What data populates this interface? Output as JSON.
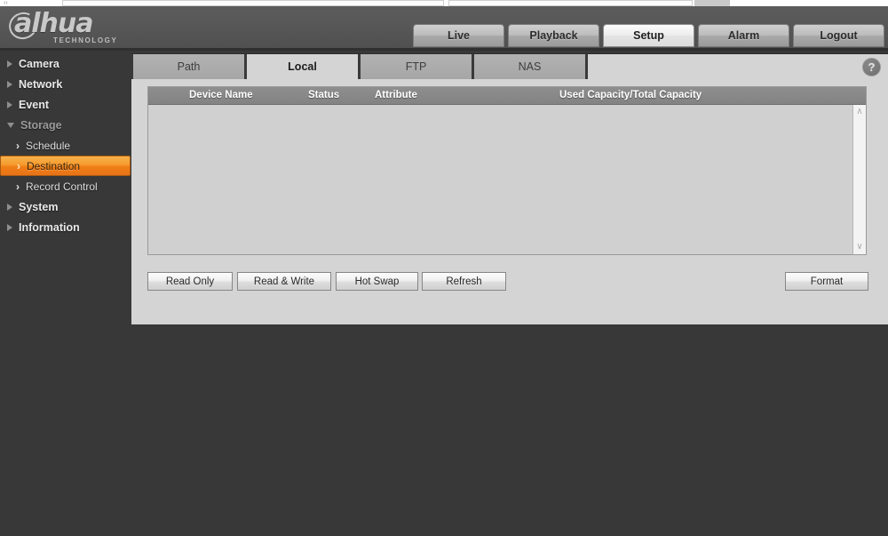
{
  "brand": {
    "name": "alhua",
    "tagline": "TECHNOLOGY"
  },
  "topnav": {
    "items": [
      {
        "label": "Live",
        "active": false
      },
      {
        "label": "Playback",
        "active": false
      },
      {
        "label": "Setup",
        "active": true
      },
      {
        "label": "Alarm",
        "active": false
      },
      {
        "label": "Logout",
        "active": false
      }
    ]
  },
  "sidebar": {
    "items": [
      {
        "label": "Camera",
        "level": 1,
        "icon": "arrow-right-icon",
        "state": "collapsed"
      },
      {
        "label": "Network",
        "level": 1,
        "icon": "arrow-right-icon",
        "state": "collapsed"
      },
      {
        "label": "Event",
        "level": 1,
        "icon": "arrow-right-icon",
        "state": "collapsed"
      },
      {
        "label": "Storage",
        "level": 1,
        "icon": "arrow-down-icon",
        "state": "expanded"
      },
      {
        "label": "Schedule",
        "level": 2,
        "icon": "chevron-right-icon",
        "state": "normal"
      },
      {
        "label": "Destination",
        "level": 2,
        "icon": "chevron-right-icon",
        "state": "selected"
      },
      {
        "label": "Record Control",
        "level": 2,
        "icon": "chevron-right-icon",
        "state": "normal"
      },
      {
        "label": "System",
        "level": 1,
        "icon": "arrow-right-icon",
        "state": "collapsed"
      },
      {
        "label": "Information",
        "level": 1,
        "icon": "arrow-right-icon",
        "state": "collapsed"
      }
    ]
  },
  "help": {
    "glyph": "?"
  },
  "tabs": [
    {
      "label": "Path",
      "active": false
    },
    {
      "label": "Local",
      "active": true
    },
    {
      "label": "FTP",
      "active": false
    },
    {
      "label": "NAS",
      "active": false
    }
  ],
  "table": {
    "columns": [
      "Device Name",
      "Status",
      "Attribute",
      "Used Capacity/Total Capacity"
    ],
    "rows": []
  },
  "scrollbar": {
    "up_glyph": "∧",
    "down_glyph": "∨"
  },
  "buttons": {
    "read_only": "Read Only",
    "read_write": "Read & Write",
    "hot_swap": "Hot Swap",
    "refresh": "Refresh",
    "format": "Format"
  },
  "colors": {
    "accent": "#ef7e14",
    "header_bar": "#565656",
    "page_background": "#383838",
    "panel_background": "#d4d4d4",
    "table_header": "#878787"
  }
}
